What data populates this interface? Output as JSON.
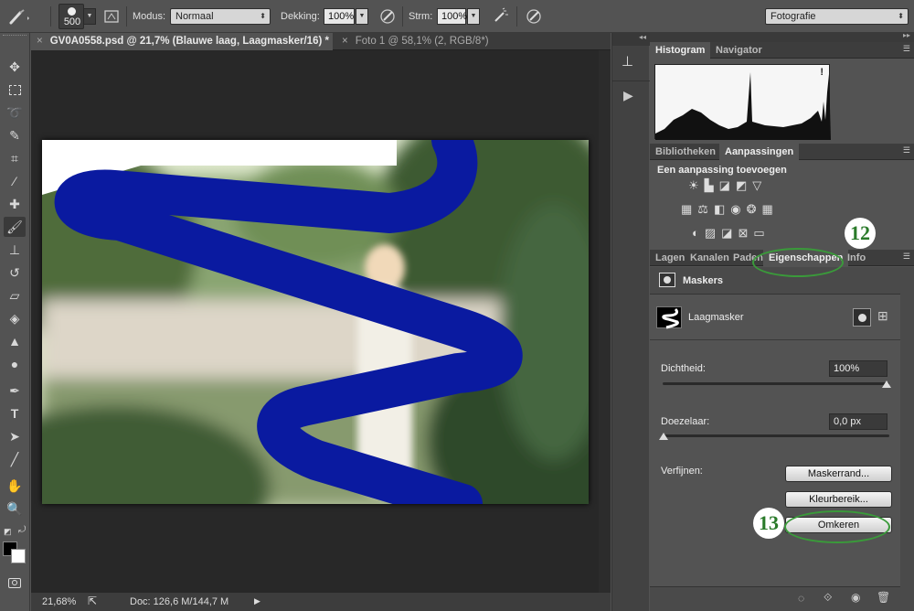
{
  "options_bar": {
    "brush_size": "500",
    "modus_label": "Modus:",
    "modus_value": "Normaal",
    "dekking_label": "Dekking:",
    "dekking_value": "100%",
    "strm_label": "Strm:",
    "strm_value": "100%",
    "workspace": "Fotografie"
  },
  "tabs": [
    {
      "title": "GV0A0558.psd @ 21,7% (Blauwe laag, Laagmasker/16) *",
      "close": "×"
    },
    {
      "title": "Foto 1 @ 58,1% (2, RGB/8*)",
      "close": "×"
    }
  ],
  "status": {
    "zoom": "21,68%",
    "doc": "Doc: 126,6 M/144,7 M"
  },
  "panels": {
    "histogram": {
      "tab1": "Histogram",
      "tab2": "Navigator",
      "warning": "!"
    },
    "adjust": {
      "tab1": "Bibliotheken",
      "tab2": "Aanpassingen",
      "heading": "Een aanpassing toevoegen"
    },
    "props": {
      "tabs": [
        "Lagen",
        "Kanalen",
        "Paden",
        "Eigenschappen",
        "Info"
      ],
      "masks_title": "Maskers",
      "mask_name": "Laagmasker",
      "density_label": "Dichtheid:",
      "density_value": "100%",
      "feather_label": "Doezelaar:",
      "feather_value": "0,0 px",
      "refine_label": "Verfijnen:",
      "btn_maskedge": "Maskerrand...",
      "btn_colorrange": "Kleurbereik...",
      "btn_invert": "Omkeren"
    }
  },
  "annotations": {
    "a12": "12",
    "a13": "13"
  },
  "colors": {
    "brush_blue": "#0a1aa0",
    "annotation_green": "#3a9a3a"
  }
}
